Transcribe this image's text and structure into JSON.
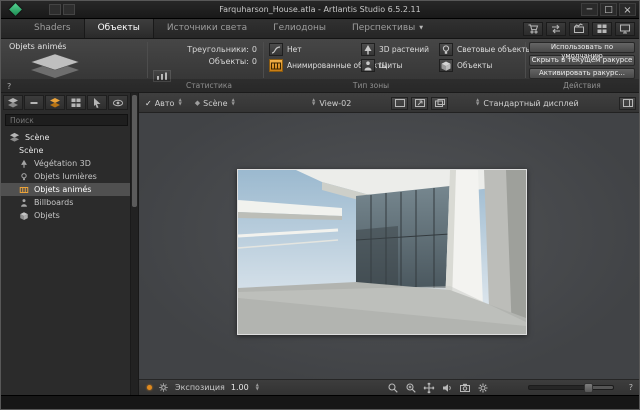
{
  "window": {
    "title": "Farquharson_House.atla - Artlantis Studio 6.5.2.11"
  },
  "menubar": {
    "tabs": [
      {
        "label": "Shaders"
      },
      {
        "label": "Объекты",
        "active": true
      },
      {
        "label": "Источники света"
      },
      {
        "label": "Гелиодоны"
      },
      {
        "label": "Перспективы",
        "has_chevron": true
      }
    ],
    "chevron": "▼"
  },
  "inspector": {
    "panel_title": "Objets animés",
    "stats": {
      "section": "Статистика",
      "rows": [
        {
          "label": "Треугольники:",
          "value": "0"
        },
        {
          "label": "Объекты:",
          "value": "0"
        }
      ]
    },
    "type_zone": {
      "section": "Тип зоны",
      "buttons": [
        {
          "label": "Нет"
        },
        {
          "label": "Анимированные объекты",
          "active": true
        },
        {
          "label": "3D растений"
        },
        {
          "label": "Щиты"
        },
        {
          "label": "Световые объекты"
        },
        {
          "label": "Объекты"
        }
      ]
    },
    "actions": {
      "section": "Действия",
      "buttons": [
        {
          "label": "Использовать по умолчанию"
        },
        {
          "label": "Скрыть в текущем ракурсе"
        },
        {
          "label": "Активировать ракурс..."
        }
      ]
    }
  },
  "sidebar": {
    "search_placeholder": "Поиск",
    "tree": [
      {
        "label": "Scène"
      },
      {
        "label": "Scène"
      },
      {
        "label": "Végétation 3D"
      },
      {
        "label": "Objets lumières"
      },
      {
        "label": "Objets animés",
        "selected": true
      },
      {
        "label": "Billboards"
      },
      {
        "label": "Objets"
      }
    ]
  },
  "viewport": {
    "auto_label": "Авто",
    "scene_label": "Scène",
    "view_label": "View-02",
    "display_label": "Стандартный дисплей"
  },
  "bottom": {
    "exposure_label": "Экспозиция",
    "exposure_value": "1.00"
  },
  "icons": {
    "check": "✓",
    "diamond": "◆",
    "spin_up": "▲",
    "spin_down": "▼",
    "help": "?",
    "minimize": "─",
    "maximize": "□",
    "close": "×"
  },
  "colors": {
    "accent_orange": "#e6952c",
    "logo_green": "#2fae6e",
    "selection_gray": "#505050",
    "viewport_bg": "#47494c"
  }
}
